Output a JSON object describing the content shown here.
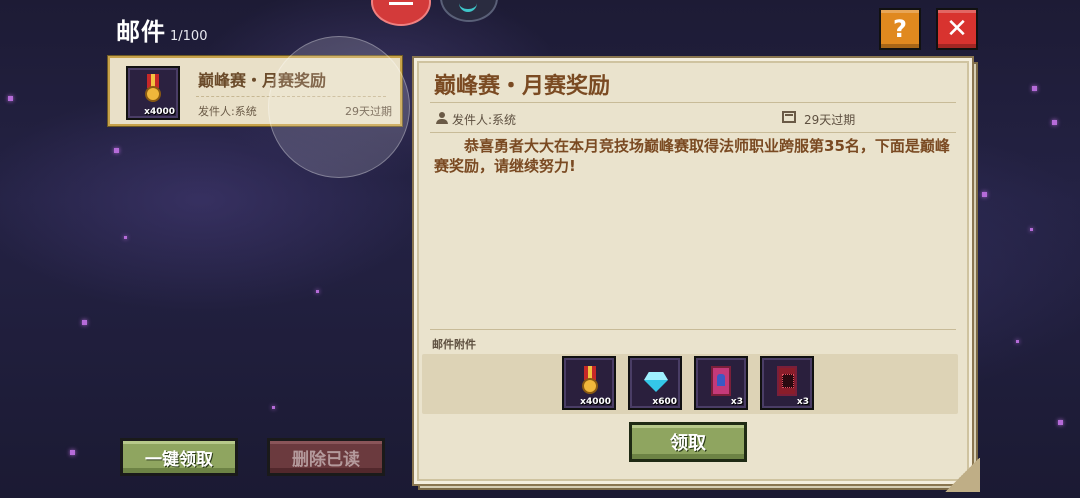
{
  "header": {
    "title": "邮件",
    "count": "1/100"
  },
  "top_buttons": {
    "help_label": "?",
    "close_label": "✕",
    "help_icon": "question-icon",
    "close_icon": "close-icon"
  },
  "mail_list": [
    {
      "title": "巅峰赛・月赛奖励",
      "sender": "发件人:系统",
      "expire": "29天过期",
      "icon": "medal-icon",
      "quantity": "x4000",
      "selected": true
    }
  ],
  "detail": {
    "title": "巅峰赛・月赛奖励",
    "sender": "发件人:系统",
    "expire": "29天过期",
    "body": "恭喜勇者大大在本月竞技场巅峰赛取得法师职业跨服第35名，下面是巅峰赛奖励，请继续努力!",
    "attachments_label": "邮件附件",
    "attachments": [
      {
        "icon": "medal-icon",
        "quantity": "x4000"
      },
      {
        "icon": "diamond-icon",
        "quantity": "x600"
      },
      {
        "icon": "blue-card-icon",
        "quantity": "x3"
      },
      {
        "icon": "red-card-icon",
        "quantity": "x3"
      }
    ],
    "claim_label": "领取"
  },
  "bottom_buttons": {
    "claim_all_label": "一键领取",
    "delete_read_label": "删除已读"
  },
  "colors": {
    "accent_green": "#8fa560",
    "title_brown": "#7a4a22",
    "close_red": "#d8332f",
    "help_orange": "#e0891f"
  }
}
